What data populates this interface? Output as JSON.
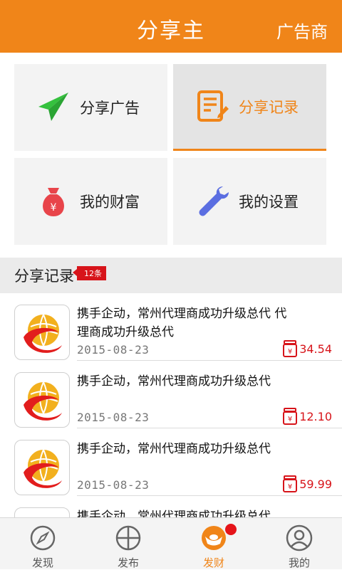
{
  "header": {
    "title": "分享主",
    "right_label": "广告商"
  },
  "tiles": [
    {
      "label": "分享广告",
      "icon": "paper-plane-icon"
    },
    {
      "label": "分享记录",
      "icon": "document-edit-icon"
    },
    {
      "label": "我的财富",
      "icon": "money-bag-icon"
    },
    {
      "label": "我的设置",
      "icon": "wrench-icon"
    }
  ],
  "section": {
    "title": "分享记录",
    "badge": "12条"
  },
  "records": [
    {
      "title": "携手企动，常州代理商成功升级总代 代理商成功升级总代",
      "date": "2015-08-23",
      "amount": "34.54"
    },
    {
      "title": "携手企动，常州代理商成功升级总代",
      "date": "2015-08-23",
      "amount": "12.10"
    },
    {
      "title": "携手企动，常州代理商成功升级总代",
      "date": "2015-08-23",
      "amount": "59.99"
    },
    {
      "title": "携手企动，常州代理商成功升级总代",
      "date": "",
      "amount": ""
    }
  ],
  "tabbar": [
    {
      "label": "发现",
      "icon": "compass-icon"
    },
    {
      "label": "发布",
      "icon": "plus-circle-icon"
    },
    {
      "label": "发财",
      "icon": "ingot-icon"
    },
    {
      "label": "我的",
      "icon": "user-icon"
    }
  ],
  "colors": {
    "accent": "#f08519",
    "red": "#d7141a",
    "green": "#35c13e",
    "blue": "#5b6ee1"
  }
}
